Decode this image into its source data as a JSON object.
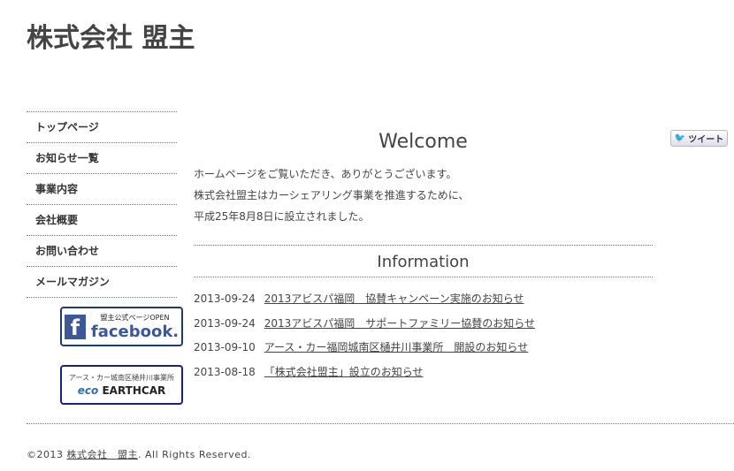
{
  "site": {
    "title": "株式会社 盟主"
  },
  "nav": [
    "トップページ",
    "お知らせ一覧",
    "事業内容",
    "会社概要",
    "お問い合わせ",
    "メールマガジン"
  ],
  "banners": {
    "facebook": {
      "top": "盟主公式ページOPEN",
      "brand": "facebook."
    },
    "earthcar": {
      "top": "アース・カー城南区樋井川事業所",
      "brand_eco": "eco",
      "brand": "EARTHCAR"
    }
  },
  "tweet": {
    "label": "ツイート",
    "icon": "twitter-bird-icon"
  },
  "main": {
    "welcome": "Welcome",
    "paragraphs": [
      "ホームページをご覧いただき、ありがとうございます。",
      "株式会社盟主はカーシェアリング事業を推進するために、",
      "平成25年8月8日に設立されました。"
    ],
    "information": "Information",
    "news": [
      {
        "date": "2013-09-24",
        "title": "2013アビスパ福岡　協賛キャンペーン実施のお知らせ"
      },
      {
        "date": "2013-09-24",
        "title": "2013アビスパ福岡　サポートファミリー協賛のお知らせ"
      },
      {
        "date": "2013-09-10",
        "title": "アース・カー福岡城南区樋井川事業所　開設のお知らせ"
      },
      {
        "date": "2013-08-18",
        "title": "「株式会社盟主」設立のお知らせ"
      }
    ]
  },
  "footer": {
    "prefix": "©2013 ",
    "link": "株式会社　盟主",
    "suffix": ". All Rights Reserved."
  }
}
